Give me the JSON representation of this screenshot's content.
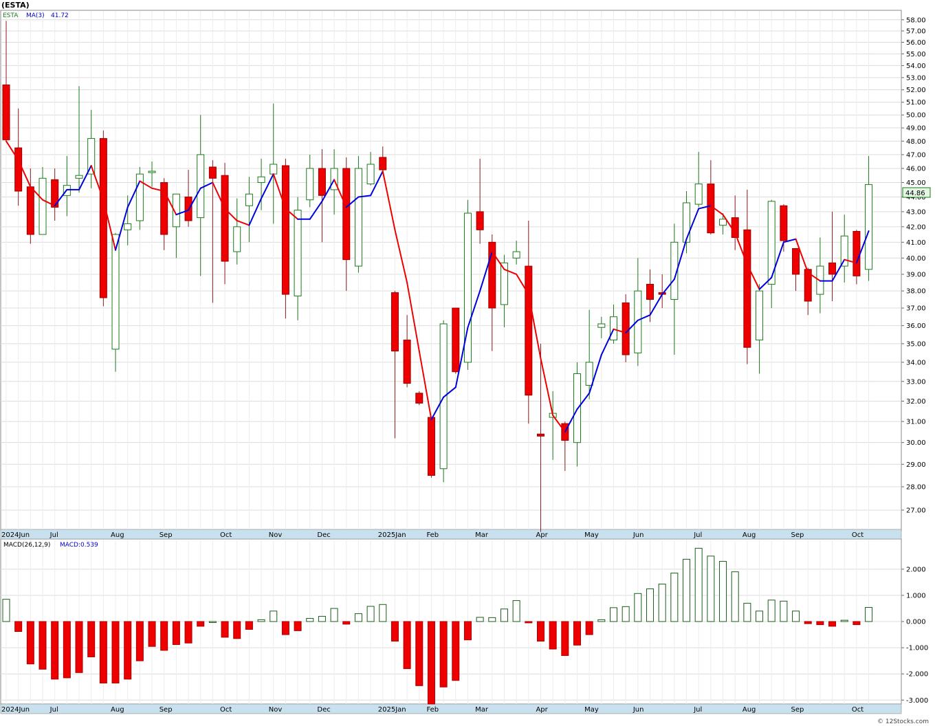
{
  "header": {
    "ticker_title": "(ESTA)"
  },
  "watermark": "© 12Stocks.com",
  "chart_data": [
    {
      "type": "candlestick",
      "legend": {
        "ticker": "ESTA",
        "ma_label": "MA(3)",
        "ma_value": "41.72"
      },
      "last_price_label": "44.86",
      "ylim": [
        26.2,
        58.8
      ],
      "scale": "log",
      "y_ticks": [
        "27.00",
        "28.00",
        "29.00",
        "30.00",
        "31.00",
        "32.00",
        "33.00",
        "34.00",
        "35.00",
        "36.00",
        "37.00",
        "38.00",
        "39.00",
        "40.00",
        "41.00",
        "42.00",
        "43.00",
        "44.00",
        "45.00",
        "46.00",
        "47.00",
        "48.00",
        "49.00",
        "50.00",
        "51.00",
        "52.00",
        "53.00",
        "54.00",
        "55.00",
        "56.00",
        "57.00",
        "58.00"
      ],
      "month_labels": [
        {
          "week": 0,
          "label": "2024Jun"
        },
        {
          "week": 4,
          "label": "Jul"
        },
        {
          "week": 9,
          "label": "Aug"
        },
        {
          "week": 13,
          "label": "Sep"
        },
        {
          "week": 18,
          "label": "Oct"
        },
        {
          "week": 22,
          "label": "Nov"
        },
        {
          "week": 26,
          "label": "Dec"
        },
        {
          "week": 31,
          "label": "2025Jan"
        },
        {
          "week": 35,
          "label": "Feb"
        },
        {
          "week": 39,
          "label": "Mar"
        },
        {
          "week": 44,
          "label": "Apr"
        },
        {
          "week": 48,
          "label": "May"
        },
        {
          "week": 52,
          "label": "Jun"
        },
        {
          "week": 57,
          "label": "Jul"
        },
        {
          "week": 61,
          "label": "Aug"
        },
        {
          "week": 65,
          "label": "Sep"
        },
        {
          "week": 70,
          "label": "Oct"
        }
      ],
      "colors": {
        "up": "#1a7a1a",
        "down": "#ee0000",
        "ma_up": "#0000dd",
        "ma_down": "#ee0000"
      },
      "candles": [
        {
          "o": 52.4,
          "h": 57.9,
          "l": 48.0,
          "c": 48.1
        },
        {
          "o": 47.5,
          "h": 50.5,
          "l": 43.4,
          "c": 44.4
        },
        {
          "o": 44.7,
          "h": 46.0,
          "l": 40.9,
          "c": 41.5
        },
        {
          "o": 41.5,
          "h": 46.1,
          "l": 41.5,
          "c": 45.3
        },
        {
          "o": 45.2,
          "h": 46.0,
          "l": 42.4,
          "c": 43.3
        },
        {
          "o": 44.1,
          "h": 46.9,
          "l": 42.7,
          "c": 44.8
        },
        {
          "o": 45.3,
          "h": 52.3,
          "l": 44.3,
          "c": 45.5
        },
        {
          "o": 45.6,
          "h": 50.4,
          "l": 44.6,
          "c": 48.2
        },
        {
          "o": 48.2,
          "h": 48.8,
          "l": 37.1,
          "c": 37.6
        },
        {
          "o": 34.7,
          "h": 41.6,
          "l": 33.5,
          "c": 41.5
        },
        {
          "o": 41.8,
          "h": 44.1,
          "l": 40.8,
          "c": 42.2
        },
        {
          "o": 42.4,
          "h": 46.1,
          "l": 41.8,
          "c": 45.6
        },
        {
          "o": 45.8,
          "h": 46.5,
          "l": 44.7,
          "c": 45.8
        },
        {
          "o": 45.0,
          "h": 45.3,
          "l": 40.5,
          "c": 41.5
        },
        {
          "o": 42.0,
          "h": 44.2,
          "l": 40.0,
          "c": 44.2
        },
        {
          "o": 44.0,
          "h": 45.9,
          "l": 42.0,
          "c": 42.4
        },
        {
          "o": 42.6,
          "h": 50.0,
          "l": 38.9,
          "c": 47.0
        },
        {
          "o": 46.1,
          "h": 46.6,
          "l": 37.3,
          "c": 45.3
        },
        {
          "o": 45.5,
          "h": 46.4,
          "l": 38.4,
          "c": 39.8
        },
        {
          "o": 40.4,
          "h": 43.9,
          "l": 39.6,
          "c": 42.0
        },
        {
          "o": 43.4,
          "h": 45.4,
          "l": 41.0,
          "c": 44.2
        },
        {
          "o": 45.0,
          "h": 46.7,
          "l": 43.1,
          "c": 45.4
        },
        {
          "o": 45.6,
          "h": 50.9,
          "l": 42.2,
          "c": 46.3
        },
        {
          "o": 46.2,
          "h": 46.7,
          "l": 36.4,
          "c": 37.8
        },
        {
          "o": 37.7,
          "h": 44.0,
          "l": 36.3,
          "c": 43.1
        },
        {
          "o": 43.8,
          "h": 47.0,
          "l": 43.3,
          "c": 46.0
        },
        {
          "o": 46.0,
          "h": 47.4,
          "l": 41.0,
          "c": 44.1
        },
        {
          "o": 44.5,
          "h": 47.4,
          "l": 42.8,
          "c": 46.0
        },
        {
          "o": 46.0,
          "h": 46.8,
          "l": 38.0,
          "c": 39.9
        },
        {
          "o": 39.5,
          "h": 46.9,
          "l": 39.1,
          "c": 46.0
        },
        {
          "o": 44.9,
          "h": 47.2,
          "l": 44.8,
          "c": 46.3
        },
        {
          "o": 46.8,
          "h": 47.6,
          "l": 45.6,
          "c": 45.9
        },
        {
          "o": 37.9,
          "h": 38.0,
          "l": 30.2,
          "c": 34.6
        },
        {
          "o": 35.2,
          "h": 36.6,
          "l": 32.7,
          "c": 32.9
        },
        {
          "o": 32.4,
          "h": 32.5,
          "l": 31.8,
          "c": 31.9
        },
        {
          "o": 31.2,
          "h": 31.2,
          "l": 28.4,
          "c": 28.5
        },
        {
          "o": 28.8,
          "h": 36.3,
          "l": 28.2,
          "c": 36.1
        },
        {
          "o": 37.0,
          "h": 37.0,
          "l": 33.4,
          "c": 33.5
        },
        {
          "o": 34.0,
          "h": 43.8,
          "l": 33.6,
          "c": 42.9
        },
        {
          "o": 43.0,
          "h": 46.7,
          "l": 40.9,
          "c": 41.8
        },
        {
          "o": 41.0,
          "h": 41.5,
          "l": 34.6,
          "c": 37.0
        },
        {
          "o": 37.2,
          "h": 40.2,
          "l": 35.9,
          "c": 39.7
        },
        {
          "o": 40.0,
          "h": 41.1,
          "l": 39.6,
          "c": 40.4
        },
        {
          "o": 39.5,
          "h": 42.4,
          "l": 30.9,
          "c": 32.3
        },
        {
          "o": 30.4,
          "h": 35.0,
          "l": 26.1,
          "c": 30.3
        },
        {
          "o": 31.2,
          "h": 32.5,
          "l": 29.2,
          "c": 31.4
        },
        {
          "o": 30.9,
          "h": 31.0,
          "l": 28.7,
          "c": 30.1
        },
        {
          "o": 30.0,
          "h": 34.0,
          "l": 28.9,
          "c": 33.4
        },
        {
          "o": 32.8,
          "h": 36.9,
          "l": 32.1,
          "c": 34.0
        },
        {
          "o": 35.9,
          "h": 36.5,
          "l": 35.3,
          "c": 36.1
        },
        {
          "o": 35.2,
          "h": 37.2,
          "l": 35.0,
          "c": 36.5
        },
        {
          "o": 37.3,
          "h": 37.8,
          "l": 34.0,
          "c": 34.4
        },
        {
          "o": 34.5,
          "h": 40.0,
          "l": 33.8,
          "c": 38.0
        },
        {
          "o": 38.4,
          "h": 39.3,
          "l": 36.2,
          "c": 37.5
        },
        {
          "o": 37.9,
          "h": 39.0,
          "l": 37.0,
          "c": 37.8
        },
        {
          "o": 37.5,
          "h": 42.2,
          "l": 34.4,
          "c": 41.0
        },
        {
          "o": 41.0,
          "h": 44.4,
          "l": 40.3,
          "c": 43.6
        },
        {
          "o": 43.5,
          "h": 47.2,
          "l": 43.3,
          "c": 44.9
        },
        {
          "o": 44.9,
          "h": 46.6,
          "l": 41.5,
          "c": 41.6
        },
        {
          "o": 42.1,
          "h": 42.9,
          "l": 41.5,
          "c": 42.5
        },
        {
          "o": 42.6,
          "h": 44.1,
          "l": 40.5,
          "c": 41.3
        },
        {
          "o": 41.8,
          "h": 44.5,
          "l": 33.9,
          "c": 34.8
        },
        {
          "o": 35.2,
          "h": 38.4,
          "l": 33.4,
          "c": 38.0
        },
        {
          "o": 38.4,
          "h": 43.8,
          "l": 37.0,
          "c": 43.7
        },
        {
          "o": 43.4,
          "h": 43.5,
          "l": 40.4,
          "c": 41.1
        },
        {
          "o": 40.6,
          "h": 40.6,
          "l": 38.0,
          "c": 39.0
        },
        {
          "o": 39.3,
          "h": 39.4,
          "l": 36.6,
          "c": 37.4
        },
        {
          "o": 37.8,
          "h": 41.3,
          "l": 36.7,
          "c": 39.5
        },
        {
          "o": 39.7,
          "h": 43.0,
          "l": 37.4,
          "c": 39.0
        },
        {
          "o": 39.5,
          "h": 42.8,
          "l": 38.5,
          "c": 41.4
        },
        {
          "o": 41.7,
          "h": 41.8,
          "l": 38.4,
          "c": 38.9
        },
        {
          "o": 39.3,
          "h": 46.9,
          "l": 38.6,
          "c": 44.86
        }
      ],
      "ma3": [
        48.0,
        46.6,
        44.7,
        43.8,
        43.4,
        44.5,
        44.5,
        46.2,
        43.8,
        40.5,
        43.3,
        45.1,
        44.6,
        44.4,
        42.8,
        43.1,
        44.6,
        45.0,
        43.2,
        42.4,
        42.1,
        43.9,
        45.6,
        43.2,
        42.5,
        42.5,
        43.7,
        45.2,
        43.3,
        44.0,
        44.1,
        45.8,
        41.8,
        38.5,
        34.6,
        31.1,
        32.2,
        32.7,
        35.9,
        38.0,
        40.4,
        39.3,
        39.0,
        37.8,
        34.2,
        31.3,
        30.5,
        31.6,
        32.4,
        34.4,
        35.8,
        35.6,
        36.3,
        36.6,
        37.8,
        38.7,
        41.2,
        43.2,
        43.4,
        42.8,
        41.6,
        39.6,
        38.1,
        38.8,
        41.0,
        41.2,
        39.1,
        38.6,
        38.6,
        39.9,
        39.7,
        41.72
      ],
      "ma_legend_value": 41.72
    },
    {
      "type": "bar",
      "legend": {
        "label": "MACD(26,12,9)",
        "value_label": "MACD:0.539"
      },
      "ylim": [
        -3.15,
        3.1
      ],
      "y_ticks": [
        "-3.000",
        "-2.000",
        "-1.000",
        "0.000",
        "1.000",
        "2.000"
      ],
      "values": [
        0.85,
        -0.38,
        -1.62,
        -1.82,
        -2.2,
        -2.15,
        -1.95,
        -1.35,
        -2.35,
        -2.35,
        -2.2,
        -1.5,
        -0.95,
        -1.1,
        -0.88,
        -0.82,
        -0.18,
        0.0,
        -0.6,
        -0.65,
        -0.3,
        0.07,
        0.4,
        -0.5,
        -0.35,
        0.12,
        0.2,
        0.5,
        -0.1,
        0.3,
        0.58,
        0.65,
        -0.75,
        -1.8,
        -2.45,
        -3.15,
        -2.5,
        -2.25,
        -0.7,
        0.16,
        0.15,
        0.48,
        0.8,
        -0.05,
        -0.75,
        -1.05,
        -1.3,
        -0.9,
        -0.5,
        0.07,
        0.53,
        0.57,
        1.07,
        1.25,
        1.43,
        1.85,
        2.38,
        2.8,
        2.5,
        2.3,
        1.9,
        0.7,
        0.4,
        0.82,
        0.78,
        0.4,
        -0.08,
        -0.12,
        -0.18,
        0.05,
        -0.12,
        0.539
      ],
      "colors": {
        "positive": "#1a5c1a",
        "negative": "#ee0000"
      }
    }
  ]
}
